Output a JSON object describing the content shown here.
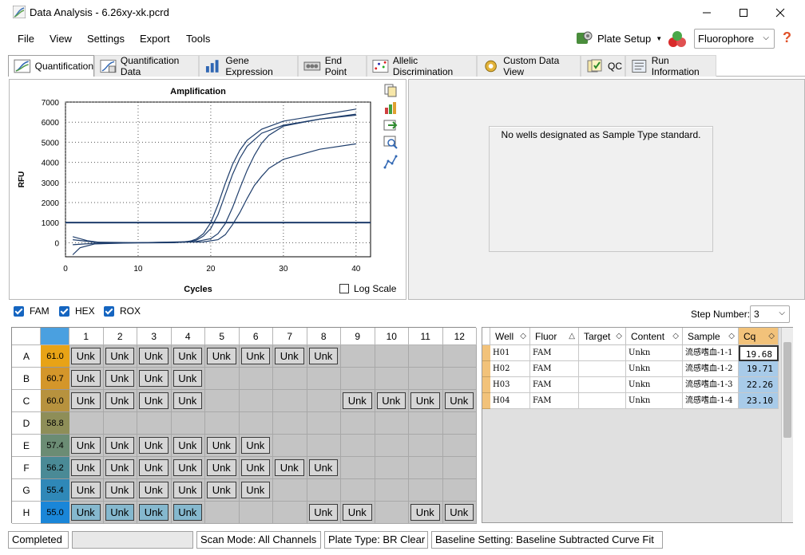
{
  "window": {
    "title": "Data Analysis - 6.26xy-xk.pcrd"
  },
  "menu": [
    "File",
    "View",
    "Settings",
    "Export",
    "Tools"
  ],
  "toolbar": {
    "plate_setup": "Plate Setup",
    "fluorophore": "Fluorophore"
  },
  "tabs": [
    {
      "label": "Quantification",
      "icon": "amplification-icon"
    },
    {
      "label": "Quantification Data",
      "icon": "quant-data-icon"
    },
    {
      "label": "Gene Expression",
      "icon": "bar-chart-icon"
    },
    {
      "label": "End Point",
      "icon": "end-point-icon"
    },
    {
      "label": "Allelic Discrimination",
      "icon": "allelic-icon"
    },
    {
      "label": "Custom Data View",
      "icon": "custom-view-icon"
    },
    {
      "label": "QC",
      "icon": "qc-icon"
    },
    {
      "label": "Run Information",
      "icon": "run-info-icon"
    }
  ],
  "log_scale_label": "Log Scale",
  "standard_message": "No wells designated as Sample Type standard.",
  "fluor_filters": [
    {
      "label": "FAM",
      "checked": true
    },
    {
      "label": "HEX",
      "checked": true
    },
    {
      "label": "ROX",
      "checked": true
    }
  ],
  "step": {
    "label": "Step Number:",
    "value": "3"
  },
  "chart_data": {
    "type": "line",
    "title": "Amplification",
    "xlabel": "Cycles",
    "ylabel": "RFU",
    "xlim": [
      0,
      42
    ],
    "ylim": [
      -700,
      7000
    ],
    "xticks": [
      0,
      10,
      20,
      30,
      40
    ],
    "yticks": [
      0,
      1000,
      2000,
      3000,
      4000,
      5000,
      6000,
      7000
    ],
    "grid": true,
    "threshold": 1000,
    "series": [
      {
        "values": [
          [
            1,
            300
          ],
          [
            3,
            100
          ],
          [
            5,
            0
          ],
          [
            10,
            -10
          ],
          [
            15,
            0
          ],
          [
            17,
            50
          ],
          [
            18,
            180
          ],
          [
            19,
            450
          ],
          [
            20,
            1000
          ],
          [
            21,
            1900
          ],
          [
            22,
            2950
          ],
          [
            23,
            3900
          ],
          [
            24,
            4600
          ],
          [
            25,
            5100
          ],
          [
            27,
            5650
          ],
          [
            30,
            6050
          ],
          [
            35,
            6350
          ],
          [
            40,
            6650
          ]
        ]
      },
      {
        "values": [
          [
            1,
            -600
          ],
          [
            2,
            -250
          ],
          [
            4,
            -60
          ],
          [
            10,
            0
          ],
          [
            16,
            30
          ],
          [
            18,
            120
          ],
          [
            19,
            330
          ],
          [
            20,
            700
          ],
          [
            21,
            1400
          ],
          [
            22,
            2400
          ],
          [
            23,
            3400
          ],
          [
            24,
            4200
          ],
          [
            25,
            4800
          ],
          [
            27,
            5450
          ],
          [
            30,
            5850
          ],
          [
            35,
            6150
          ],
          [
            40,
            6400
          ]
        ]
      },
      {
        "values": [
          [
            1,
            150
          ],
          [
            4,
            30
          ],
          [
            10,
            0
          ],
          [
            18,
            60
          ],
          [
            20,
            200
          ],
          [
            21,
            450
          ],
          [
            22,
            950
          ],
          [
            23,
            1750
          ],
          [
            24,
            2700
          ],
          [
            25,
            3600
          ],
          [
            26,
            4350
          ],
          [
            27,
            4950
          ],
          [
            28,
            5350
          ],
          [
            30,
            5800
          ],
          [
            35,
            6150
          ],
          [
            40,
            6350
          ]
        ]
      },
      {
        "values": [
          [
            1,
            -100
          ],
          [
            4,
            -30
          ],
          [
            10,
            0
          ],
          [
            19,
            40
          ],
          [
            21,
            150
          ],
          [
            22,
            400
          ],
          [
            23,
            900
          ],
          [
            24,
            1500
          ],
          [
            25,
            2200
          ],
          [
            26,
            2850
          ],
          [
            27,
            3300
          ],
          [
            28,
            3700
          ],
          [
            30,
            4150
          ],
          [
            35,
            4650
          ],
          [
            40,
            4920
          ]
        ]
      }
    ]
  },
  "plate": {
    "columns": [
      "1",
      "2",
      "3",
      "4",
      "5",
      "6",
      "7",
      "8",
      "9",
      "10",
      "11",
      "12"
    ],
    "rows": [
      {
        "label": "A",
        "temp": "61.0",
        "color": "#e8a316",
        "wells": [
          "Unk",
          "Unk",
          "Unk",
          "Unk",
          "Unk",
          "Unk",
          "Unk",
          "Unk",
          "",
          "",
          "",
          ""
        ]
      },
      {
        "label": "B",
        "temp": "60.7",
        "color": "#d4962a",
        "wells": [
          "Unk",
          "Unk",
          "Unk",
          "Unk",
          "",
          "",
          "",
          "",
          "",
          "",
          "",
          ""
        ]
      },
      {
        "label": "C",
        "temp": "60.0",
        "color": "#b7923e",
        "wells": [
          "Unk",
          "Unk",
          "Unk",
          "Unk",
          "",
          "",
          "",
          "",
          "Unk",
          "Unk",
          "Unk",
          "Unk"
        ]
      },
      {
        "label": "D",
        "temp": "58.8",
        "color": "#8e8e58",
        "wells": [
          "",
          "",
          "",
          "",
          "",
          "",
          "",
          "",
          "",
          "",
          "",
          ""
        ]
      },
      {
        "label": "E",
        "temp": "57.4",
        "color": "#6b8c74",
        "wells": [
          "Unk",
          "Unk",
          "Unk",
          "Unk",
          "Unk",
          "Unk",
          "",
          "",
          "",
          "",
          "",
          ""
        ]
      },
      {
        "label": "F",
        "temp": "56.2",
        "color": "#4a8a96",
        "wells": [
          "Unk",
          "Unk",
          "Unk",
          "Unk",
          "Unk",
          "Unk",
          "Unk",
          "Unk",
          "",
          "",
          "",
          ""
        ]
      },
      {
        "label": "G",
        "temp": "55.4",
        "color": "#2f88b8",
        "wells": [
          "Unk",
          "Unk",
          "Unk",
          "Unk",
          "Unk",
          "Unk",
          "",
          "",
          "",
          "",
          "",
          ""
        ]
      },
      {
        "label": "H",
        "temp": "55.0",
        "color": "#1a86d8",
        "wells": [
          "Unk",
          "Unk",
          "Unk",
          "Unk",
          "",
          "",
          "",
          "Unk",
          "Unk",
          "",
          "Unk",
          "Unk"
        ]
      }
    ]
  },
  "table": {
    "headers": [
      "Well",
      "Fluor",
      "Target",
      "Content",
      "Sample",
      "Cq"
    ],
    "rows": [
      {
        "well": "H01",
        "fluor": "FAM",
        "target": "",
        "content": "Unkn",
        "sample": "流感嗜血-1-1",
        "cq": "19.68"
      },
      {
        "well": "H02",
        "fluor": "FAM",
        "target": "",
        "content": "Unkn",
        "sample": "流感嗜血-1-2",
        "cq": "19.71"
      },
      {
        "well": "H03",
        "fluor": "FAM",
        "target": "",
        "content": "Unkn",
        "sample": "流感嗜血-1-3",
        "cq": "22.26"
      },
      {
        "well": "H04",
        "fluor": "FAM",
        "target": "",
        "content": "Unkn",
        "sample": "流感嗜血-1-4",
        "cq": "23.10"
      }
    ]
  },
  "status": {
    "state": "Completed",
    "scan_mode": "Scan Mode: All Channels",
    "plate_type": "Plate Type: BR Clear",
    "baseline": "Baseline Setting: Baseline Subtracted Curve Fit"
  }
}
